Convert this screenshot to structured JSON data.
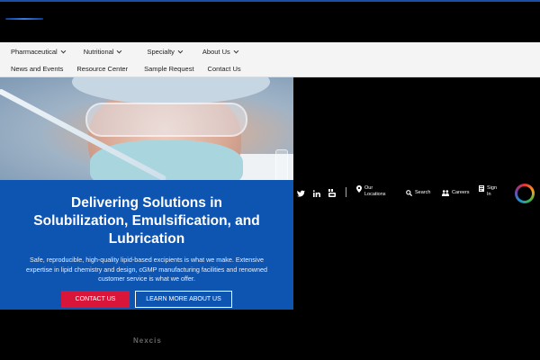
{
  "nav": {
    "row1": [
      {
        "label": "Pharmaceutical",
        "dropdown": true
      },
      {
        "label": "Nutritional",
        "dropdown": true
      },
      {
        "label": "Specialty",
        "dropdown": true
      },
      {
        "label": "About Us",
        "dropdown": true
      }
    ],
    "row2": [
      {
        "label": "News and Events"
      },
      {
        "label": "Resource Center"
      },
      {
        "label": "Sample Request"
      },
      {
        "label": "Contact Us"
      }
    ]
  },
  "hero": {
    "title_line1": "Delivering Solutions in",
    "title_line2": "Solubilization, Emulsification, and",
    "title_line3": "Lubrication",
    "text": "Safe, reproducible, high-quality lipid-based excipients is what we make. Extensive expertise in lipid chemistry and design, cGMP manufacturing facilities and renowned customer service is what we offer.",
    "contact_button": "CONTACT US",
    "learn_button": "LEARN MORE ABOUT US"
  },
  "utility": {
    "locations_line1": "Our",
    "locations_line2": "Locations",
    "search": "Search",
    "careers": "Careers",
    "signin_line1": "Sign",
    "signin_line2": "In"
  },
  "footer": {
    "logo_text": "Nexcis"
  },
  "colors": {
    "accent_blue": "#0e55b2",
    "accent_red": "#d9163a",
    "nav_bg": "#f4f4f4"
  },
  "icons": [
    "twitter-icon",
    "linkedin-icon",
    "youtube-icon",
    "location-pin-icon",
    "search-icon",
    "careers-icon",
    "sign-in-icon",
    "brand-ring-icon"
  ]
}
